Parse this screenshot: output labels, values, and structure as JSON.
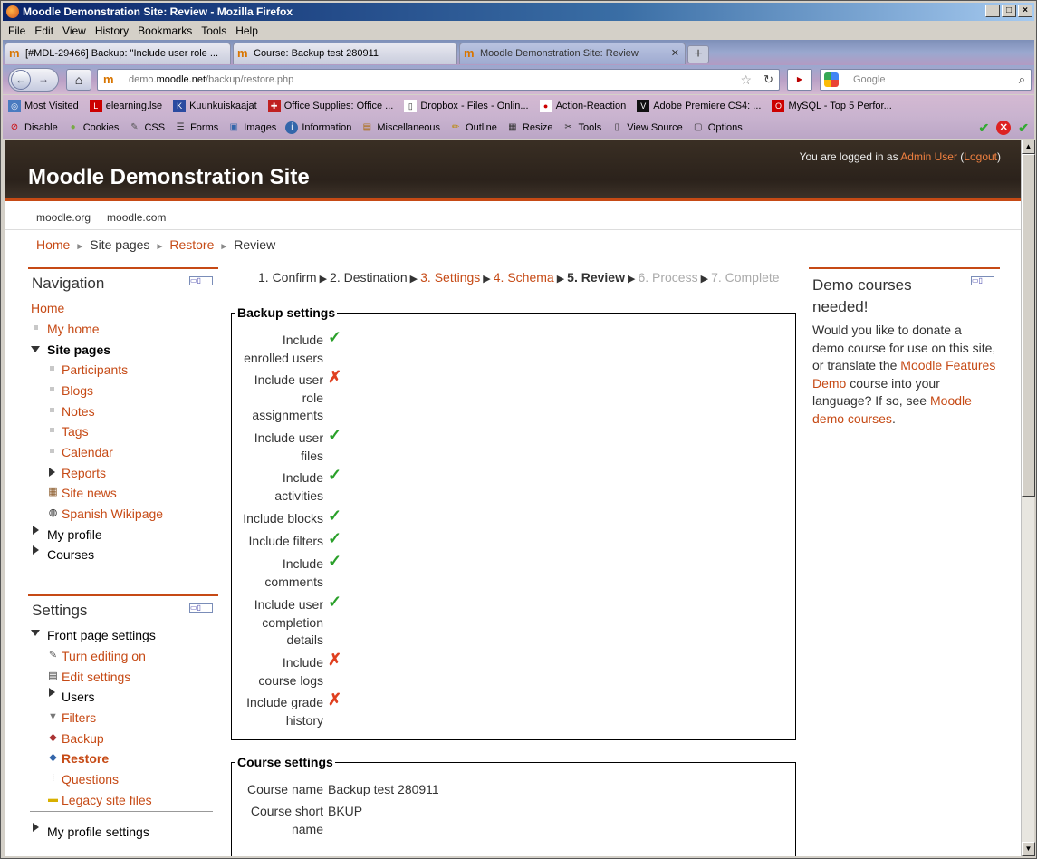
{
  "window": {
    "title": "Moodle Demonstration Site: Review - Mozilla Firefox"
  },
  "menubar": [
    "File",
    "Edit",
    "View",
    "History",
    "Bookmarks",
    "Tools",
    "Help"
  ],
  "tabs": [
    {
      "label": "[#MDL-29466] Backup: \"Include user role ..."
    },
    {
      "label": "Course: Backup test 280911"
    },
    {
      "label": "Moodle Demonstration Site: Review"
    }
  ],
  "url": {
    "prefix": "demo.",
    "domain": "moodle.net",
    "path": "/backup/restore.php"
  },
  "search": {
    "placeholder": "Google"
  },
  "bookmarks": [
    "Most Visited",
    "elearning.lse",
    "Kuunkuiskaajat",
    "Office Supplies: Office ...",
    "Dropbox - Files - Onlin...",
    "Action-Reaction",
    "Adobe Premiere CS4: ...",
    "MySQL - Top 5 Perfor..."
  ],
  "devtoolbar": [
    "Disable",
    "Cookies",
    "CSS",
    "Forms",
    "Images",
    "Information",
    "Miscellaneous",
    "Outline",
    "Resize",
    "Tools",
    "View Source",
    "Options"
  ],
  "page": {
    "site_title": "Moodle Demonstration Site",
    "login": {
      "prefix": "You are logged in as ",
      "user": "Admin User",
      "open": " (",
      "logout": "Logout",
      "close": ")"
    },
    "custom_menu": [
      "moodle.org",
      "moodle.com"
    ],
    "breadcrumb": {
      "home": "Home",
      "sitepages": "Site pages",
      "restore": "Restore",
      "current": "Review"
    },
    "navigation": {
      "title": "Navigation",
      "home": "Home",
      "myhome": "My home",
      "sitepages": "Site pages",
      "participants": "Participants",
      "blogs": "Blogs",
      "notes": "Notes",
      "tags": "Tags",
      "calendar": "Calendar",
      "reports": "Reports",
      "sitenews": "Site news",
      "spanish": "Spanish Wikipage",
      "myprofile": "My profile",
      "courses": "Courses"
    },
    "settings": {
      "title": "Settings",
      "frontpage": "Front page settings",
      "editing": "Turn editing on",
      "editsettings": "Edit settings",
      "users": "Users",
      "filters": "Filters",
      "backup": "Backup",
      "restore": "Restore",
      "questions": "Questions",
      "legacy": "Legacy site files",
      "myprofile": "My profile settings"
    },
    "steps": {
      "s1": "1. Confirm",
      "s2": "2. Destination",
      "s3": "3. Settings",
      "s4": "4. Schema",
      "s5": "5. Review",
      "s6": "6. Process",
      "s7": "7. Complete"
    },
    "backup_settings": {
      "legend": "Backup settings",
      "rows": [
        {
          "label": "Include enrolled users",
          "value": "✓"
        },
        {
          "label": "Include user role assignments",
          "value": "✗"
        },
        {
          "label": "Include user files",
          "value": "✓"
        },
        {
          "label": "Include activities",
          "value": "✓"
        },
        {
          "label": "Include blocks",
          "value": "✓"
        },
        {
          "label": "Include filters",
          "value": "✓"
        },
        {
          "label": "Include comments",
          "value": "✓"
        },
        {
          "label": "Include user completion details",
          "value": "✓"
        },
        {
          "label": "Include course logs",
          "value": "✗"
        },
        {
          "label": "Include grade history",
          "value": "✗"
        }
      ]
    },
    "course_settings": {
      "legend": "Course settings",
      "name_label": "Course name",
      "name_value": "Backup test 280911",
      "short_label": "Course short name",
      "short_value": "BKUP"
    },
    "demo": {
      "title": "Demo courses needed!",
      "t1": "Would you like to donate a demo course for use on this site, or translate the ",
      "link1": "Moodle Features Demo",
      "t2": " course into your language? If so, see ",
      "link2": "Moodle demo courses",
      "t3": "."
    }
  }
}
